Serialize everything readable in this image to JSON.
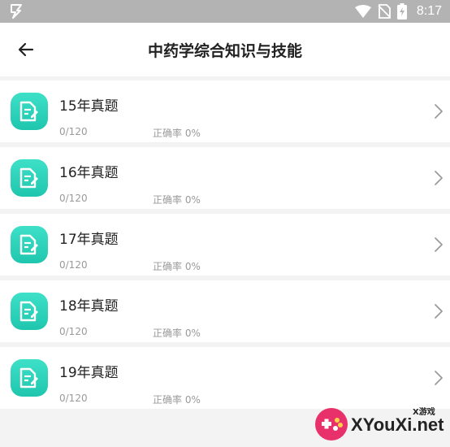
{
  "status_bar": {
    "time": "8:17",
    "left_icon": "bolt-icon",
    "right_icons": [
      "wifi-icon",
      "no-sim-icon",
      "battery-charging-icon"
    ]
  },
  "header": {
    "back_icon": "arrow-left-icon",
    "title": "中药学综合知识与技能"
  },
  "items": [
    {
      "title": "15年真题",
      "progress": "0/120",
      "accuracy": "正确率 0%"
    },
    {
      "title": "16年真题",
      "progress": "0/120",
      "accuracy": "正确率 0%"
    },
    {
      "title": "17年真题",
      "progress": "0/120",
      "accuracy": "正确率 0%"
    },
    {
      "title": "18年真题",
      "progress": "0/120",
      "accuracy": "正确率 0%"
    },
    {
      "title": "19年真题",
      "progress": "0/120",
      "accuracy": "正确率 0%"
    }
  ],
  "watermark": {
    "text": "XYouXi.net",
    "sub": "X游戏"
  },
  "colors": {
    "accent": "#2bd3bb",
    "status_bar": "#b3b3b3"
  }
}
